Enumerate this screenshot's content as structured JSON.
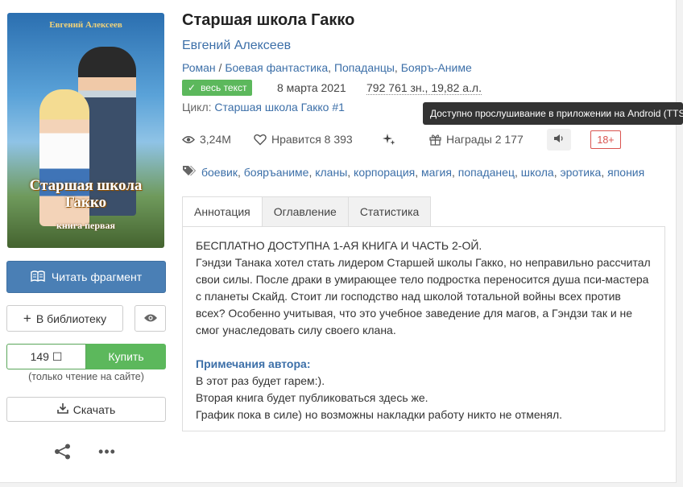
{
  "book": {
    "title": "Старшая школа Гакко",
    "author": "Евгений Алексеев",
    "genres": [
      "Роман",
      "Боевая фантастика",
      "Попаданцы",
      "Бояръ-Аниме"
    ],
    "badge": "весь текст",
    "date": "8 марта 2021",
    "size": "792 761 зн., 19,82 а.л.",
    "cycle_label": "Цикл:",
    "cycle_name": "Старшая школа Гакко #1",
    "views": "3,24M",
    "likes_label": "Нравится",
    "likes": "8 393",
    "awards_label": "Награды",
    "awards": "2 177",
    "age": "18+",
    "tags": [
      "боевик",
      "бояръаниме",
      "кланы",
      "корпорация",
      "магия",
      "попаданец",
      "школа",
      "эротика",
      "япония"
    ]
  },
  "cover": {
    "author": "Евгений Алексеев",
    "title_line1": "Старшая школа",
    "title_line2": "Гакко",
    "subtitle": "книга первая"
  },
  "tooltip": "Доступно прослушивание в приложении на Android (TTS)",
  "actions": {
    "read": "Читать фрагмент",
    "library": "В библиотеку",
    "price": "149 ☐",
    "buy": "Купить",
    "buy_note": "(только чтение на сайте)",
    "download": "Скачать"
  },
  "tabs": [
    "Аннотация",
    "Оглавление",
    "Статистика"
  ],
  "annotation": {
    "lines": [
      "БЕСПЛАТНО ДОСТУПНА 1-АЯ КНИГА И ЧАСТЬ 2-ОЙ.",
      "Гэндзи Танака хотел стать лидером Старшей школы Гакко, но неправильно рассчитал",
      "свои силы. После драки в умирающее тело подростка переносится душа пси-мастера",
      "с планеты Скайд. Стоит ли господство над школой тотальной войны всех против",
      "всех? Особенно учитывая, что это учебное заведение для магов, а Гэндзи так и не",
      "смог унаследовать силу своего клана."
    ],
    "notes_heading": "Примечания автора:",
    "notes": [
      "В этот раз будет гарем:).",
      "Вторая книга будет публиковаться здесь же.",
      "График пока в силе) но возможны накладки работу никто не отменял."
    ]
  }
}
